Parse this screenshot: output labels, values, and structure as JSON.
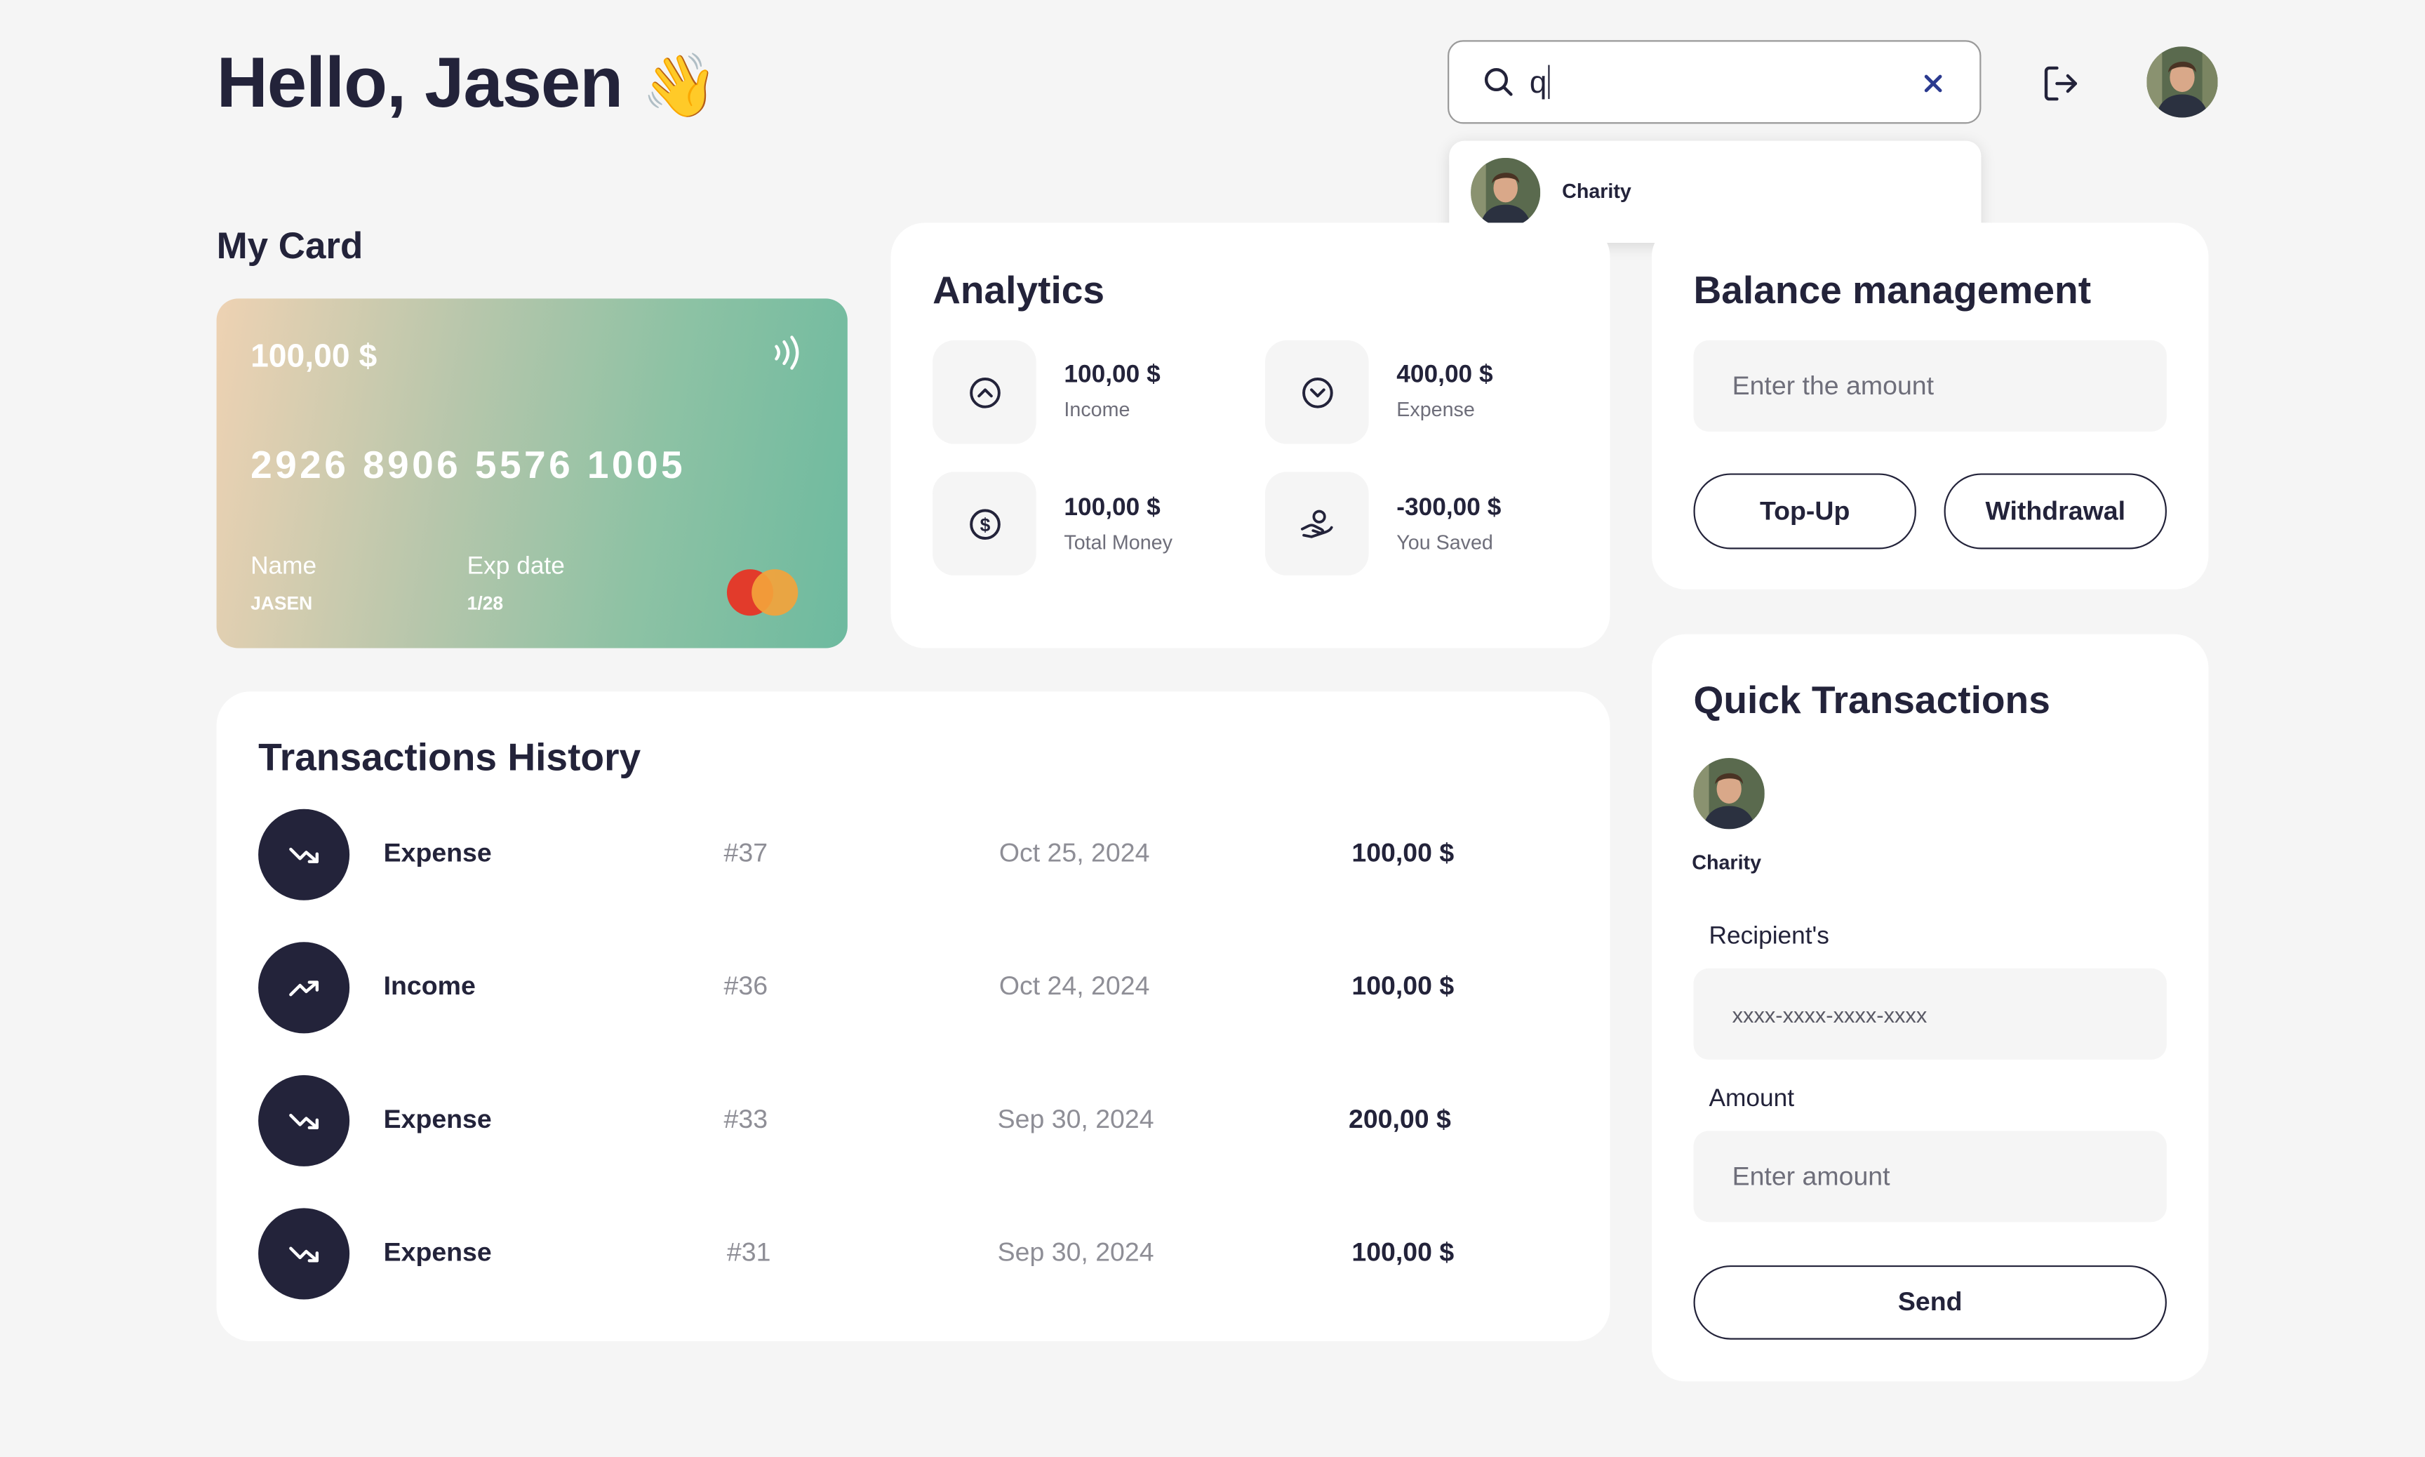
{
  "header": {
    "greeting": "Hello, Jasen",
    "wave_emoji": "👋",
    "search_value": "q",
    "search_icon": "search-icon",
    "clear_icon": "close-icon",
    "logout_icon": "logout-icon",
    "avatar_name": "user-avatar"
  },
  "search_dropdown": {
    "items": [
      {
        "label": "Charity"
      }
    ]
  },
  "my_card": {
    "title": "My Card",
    "balance": "100,00 $",
    "number": "2926 8906 5576 1005",
    "name_label": "Name",
    "name_value": "JASEN",
    "exp_label": "Exp date",
    "exp_value": "1/28",
    "contactless_icon": "contactless-icon",
    "brand_icon": "mastercard-logo"
  },
  "analytics": {
    "title": "Analytics",
    "items": [
      {
        "value": "100,00 $",
        "label": "Income",
        "icon": "arrow-up-circle-icon"
      },
      {
        "value": "400,00 $",
        "label": "Expense",
        "icon": "arrow-down-circle-icon"
      },
      {
        "value": "100,00 $",
        "label": "Total Money",
        "icon": "dollar-circle-icon"
      },
      {
        "value": "-300,00 $",
        "label": "You Saved",
        "icon": "hand-coin-icon"
      }
    ]
  },
  "balance_management": {
    "title": "Balance management",
    "amount_placeholder": "Enter the amount",
    "topup_label": "Top-Up",
    "withdrawal_label": "Withdrawal"
  },
  "transactions": {
    "title": "Transactions History",
    "rows": [
      {
        "type": "Expense",
        "id": "#37",
        "date": "Oct 25, 2024",
        "amount": "100,00 $",
        "icon": "trend-down-icon"
      },
      {
        "type": "Income",
        "id": "#36",
        "date": "Oct 24, 2024",
        "amount": "100,00 $",
        "icon": "trend-up-icon"
      },
      {
        "type": "Expense",
        "id": "#33",
        "date": "Sep 30, 2024",
        "amount": "200,00 $",
        "icon": "trend-down-icon"
      },
      {
        "type": "Expense",
        "id": "#31",
        "date": "Sep 30, 2024",
        "amount": "100,00 $",
        "icon": "trend-down-icon"
      }
    ]
  },
  "quick_transactions": {
    "title": "Quick Transactions",
    "contact_name": "Charity",
    "recipient_label": "Recipient's",
    "recipient_placeholder": "xxxx-xxxx-xxxx-xxxx",
    "amount_label": "Amount",
    "amount_placeholder": "Enter amount",
    "send_label": "Send"
  },
  "colors": {
    "background": "#f5f5f5",
    "panel": "#ffffff",
    "text_dark": "#23233a",
    "muted": "#8e8e96",
    "card_gradient_start": "#eed2b3",
    "card_gradient_end": "#6dba9f",
    "mastercard_red": "#e23b2b",
    "mastercard_orange": "#f3a33b"
  }
}
